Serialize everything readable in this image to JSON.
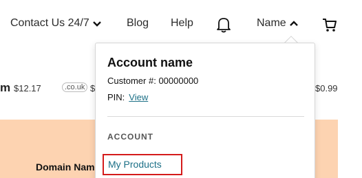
{
  "nav": {
    "contact_label": "Contact Us 24/7",
    "blog_label": "Blog",
    "help_label": "Help",
    "name_label": "Name",
    "icons": [
      "chevron-down-icon",
      "bell-icon",
      "chevron-up-icon",
      "cart-icon"
    ]
  },
  "background": {
    "tld_m": "m",
    "price_1": "$12.17",
    "tld_couk": ".co.uk",
    "price_2": "$",
    "price_3": "$0.99",
    "table_header": "Domain Nam"
  },
  "account_menu": {
    "title": "Account name",
    "customer_label": "Customer #:",
    "customer_number": "00000000",
    "pin_label": "PIN:",
    "pin_link": "View",
    "section_heading": "ACCOUNT",
    "items": [
      {
        "label": "My Products"
      }
    ]
  },
  "colors": {
    "link": "#1b6f86",
    "highlight_border": "#d41a1a",
    "peach_band": "#fdd3b1"
  }
}
